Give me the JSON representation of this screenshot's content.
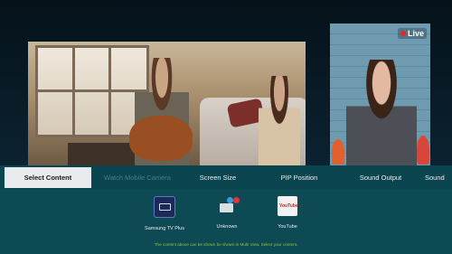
{
  "video": {
    "main": {
      "label": ""
    },
    "pip": {
      "live_label": "Live"
    }
  },
  "tabs": [
    {
      "label": "Select Content",
      "state": "selected"
    },
    {
      "label": "Watch Mobile Camera",
      "state": "disabled"
    },
    {
      "label": "Screen Size",
      "state": "normal"
    },
    {
      "label": "PIP Position",
      "state": "normal"
    },
    {
      "label": "Sound Output",
      "state": "normal"
    },
    {
      "label": "Sound",
      "state": "normal"
    }
  ],
  "sources": [
    {
      "label": "Samsung TV Plus",
      "icon": "samsung-tv-plus-icon"
    },
    {
      "label": "Unknown",
      "icon": "device-icon"
    },
    {
      "label": "YouTube",
      "icon": "youtube-icon",
      "icon_text": "YouTube"
    }
  ],
  "hint": "The content above can be shown be shown in Multi View. Select your content.",
  "colors": {
    "panel": "#0d4a54",
    "selected_tab": "#e8ecee",
    "live": "#e5262b",
    "hint_text": "#8fc63f"
  }
}
